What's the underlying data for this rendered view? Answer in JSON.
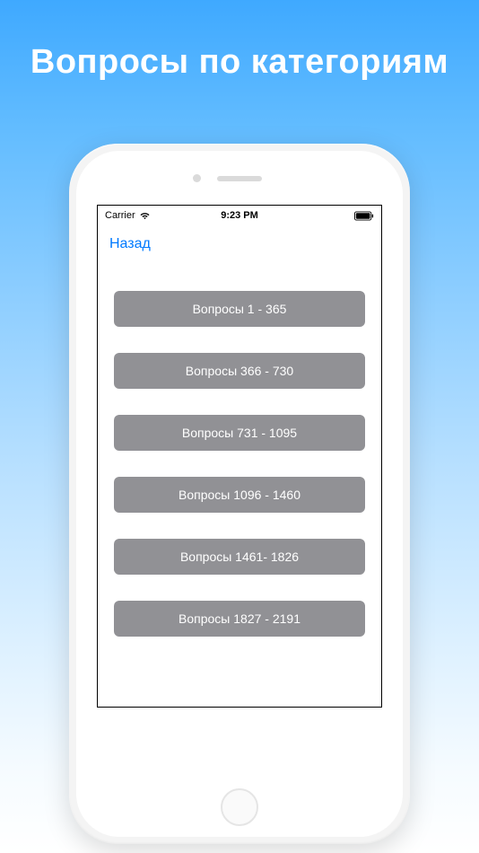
{
  "page": {
    "title": "Вопросы по категориям"
  },
  "statusBar": {
    "carrier": "Carrier",
    "time": "9:23 PM"
  },
  "nav": {
    "back": "Назад"
  },
  "categories": [
    {
      "label": "Вопросы 1 - 365"
    },
    {
      "label": "Вопросы 366 - 730"
    },
    {
      "label": "Вопросы 731 - 1095"
    },
    {
      "label": "Вопросы 1096 - 1460"
    },
    {
      "label": "Вопросы 1461- 1826"
    },
    {
      "label": "Вопросы 1827 - 2191"
    }
  ]
}
